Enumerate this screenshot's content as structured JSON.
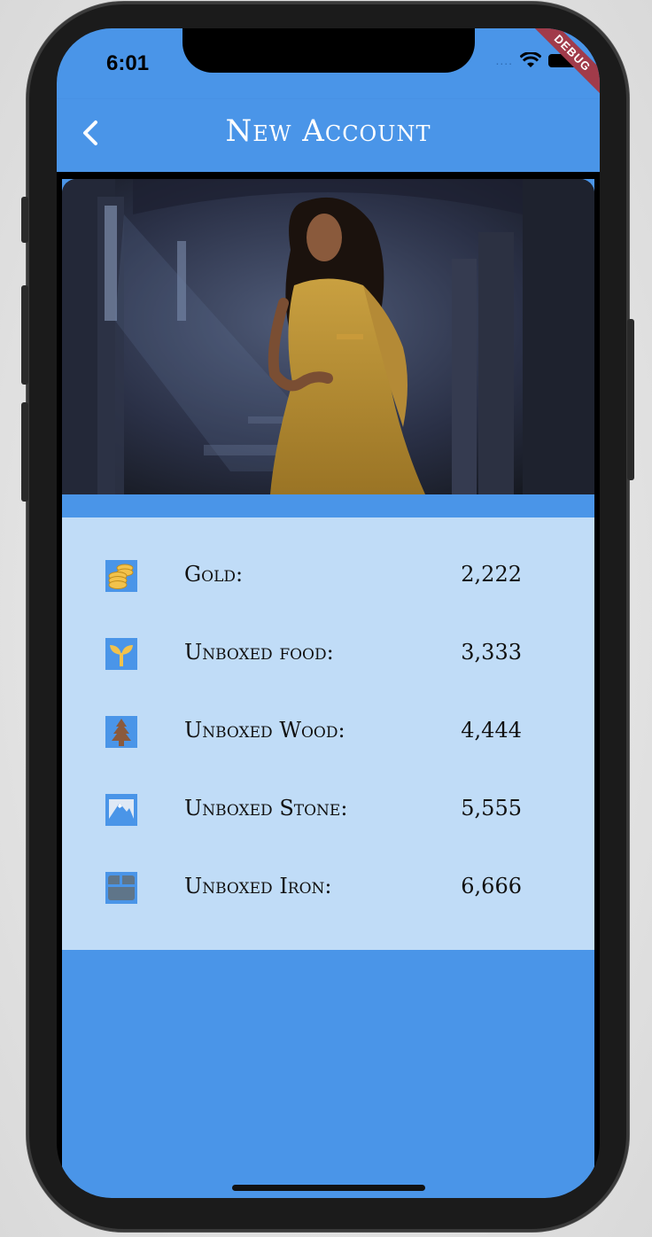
{
  "status_bar": {
    "time": "6:01",
    "signal": "....",
    "debug_banner": "DEBUG"
  },
  "appbar": {
    "title": "New Account",
    "back_icon": "chevron-left-icon"
  },
  "hero": {
    "image": "woman-in-yellow-dress-illustration"
  },
  "resources": [
    {
      "icon": "gold-coins-icon",
      "label": "Gold:",
      "value": "2,222"
    },
    {
      "icon": "sprout-food-icon",
      "label": "Unboxed food:",
      "value": "3,333"
    },
    {
      "icon": "pine-tree-wood-icon",
      "label": "Unboxed Wood:",
      "value": "4,444"
    },
    {
      "icon": "mountain-stone-icon",
      "label": "Unboxed Stone:",
      "value": "5,555"
    },
    {
      "icon": "chest-iron-icon",
      "label": "Unboxed Iron:",
      "value": "6,666"
    }
  ],
  "colors": {
    "primary": "#4a95e8",
    "panel": "#c0dcf7",
    "debug": "#a13b4a"
  }
}
